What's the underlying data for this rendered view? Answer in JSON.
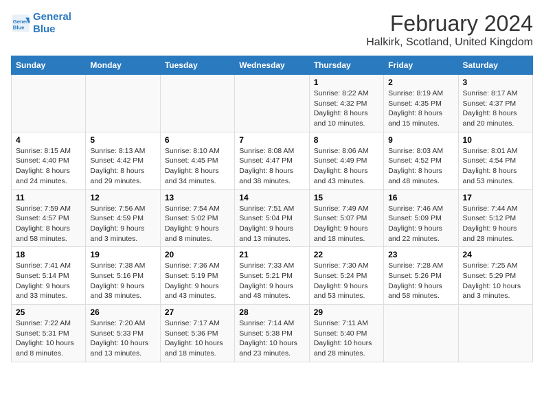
{
  "logo": {
    "line1": "General",
    "line2": "Blue"
  },
  "title": "February 2024",
  "subtitle": "Halkirk, Scotland, United Kingdom",
  "days_of_week": [
    "Sunday",
    "Monday",
    "Tuesday",
    "Wednesday",
    "Thursday",
    "Friday",
    "Saturday"
  ],
  "weeks": [
    [
      {
        "day": "",
        "content": ""
      },
      {
        "day": "",
        "content": ""
      },
      {
        "day": "",
        "content": ""
      },
      {
        "day": "",
        "content": ""
      },
      {
        "day": "1",
        "content": "Sunrise: 8:22 AM\nSunset: 4:32 PM\nDaylight: 8 hours\nand 10 minutes."
      },
      {
        "day": "2",
        "content": "Sunrise: 8:19 AM\nSunset: 4:35 PM\nDaylight: 8 hours\nand 15 minutes."
      },
      {
        "day": "3",
        "content": "Sunrise: 8:17 AM\nSunset: 4:37 PM\nDaylight: 8 hours\nand 20 minutes."
      }
    ],
    [
      {
        "day": "4",
        "content": "Sunrise: 8:15 AM\nSunset: 4:40 PM\nDaylight: 8 hours\nand 24 minutes."
      },
      {
        "day": "5",
        "content": "Sunrise: 8:13 AM\nSunset: 4:42 PM\nDaylight: 8 hours\nand 29 minutes."
      },
      {
        "day": "6",
        "content": "Sunrise: 8:10 AM\nSunset: 4:45 PM\nDaylight: 8 hours\nand 34 minutes."
      },
      {
        "day": "7",
        "content": "Sunrise: 8:08 AM\nSunset: 4:47 PM\nDaylight: 8 hours\nand 38 minutes."
      },
      {
        "day": "8",
        "content": "Sunrise: 8:06 AM\nSunset: 4:49 PM\nDaylight: 8 hours\nand 43 minutes."
      },
      {
        "day": "9",
        "content": "Sunrise: 8:03 AM\nSunset: 4:52 PM\nDaylight: 8 hours\nand 48 minutes."
      },
      {
        "day": "10",
        "content": "Sunrise: 8:01 AM\nSunset: 4:54 PM\nDaylight: 8 hours\nand 53 minutes."
      }
    ],
    [
      {
        "day": "11",
        "content": "Sunrise: 7:59 AM\nSunset: 4:57 PM\nDaylight: 8 hours\nand 58 minutes."
      },
      {
        "day": "12",
        "content": "Sunrise: 7:56 AM\nSunset: 4:59 PM\nDaylight: 9 hours\nand 3 minutes."
      },
      {
        "day": "13",
        "content": "Sunrise: 7:54 AM\nSunset: 5:02 PM\nDaylight: 9 hours\nand 8 minutes."
      },
      {
        "day": "14",
        "content": "Sunrise: 7:51 AM\nSunset: 5:04 PM\nDaylight: 9 hours\nand 13 minutes."
      },
      {
        "day": "15",
        "content": "Sunrise: 7:49 AM\nSunset: 5:07 PM\nDaylight: 9 hours\nand 18 minutes."
      },
      {
        "day": "16",
        "content": "Sunrise: 7:46 AM\nSunset: 5:09 PM\nDaylight: 9 hours\nand 22 minutes."
      },
      {
        "day": "17",
        "content": "Sunrise: 7:44 AM\nSunset: 5:12 PM\nDaylight: 9 hours\nand 28 minutes."
      }
    ],
    [
      {
        "day": "18",
        "content": "Sunrise: 7:41 AM\nSunset: 5:14 PM\nDaylight: 9 hours\nand 33 minutes."
      },
      {
        "day": "19",
        "content": "Sunrise: 7:38 AM\nSunset: 5:16 PM\nDaylight: 9 hours\nand 38 minutes."
      },
      {
        "day": "20",
        "content": "Sunrise: 7:36 AM\nSunset: 5:19 PM\nDaylight: 9 hours\nand 43 minutes."
      },
      {
        "day": "21",
        "content": "Sunrise: 7:33 AM\nSunset: 5:21 PM\nDaylight: 9 hours\nand 48 minutes."
      },
      {
        "day": "22",
        "content": "Sunrise: 7:30 AM\nSunset: 5:24 PM\nDaylight: 9 hours\nand 53 minutes."
      },
      {
        "day": "23",
        "content": "Sunrise: 7:28 AM\nSunset: 5:26 PM\nDaylight: 9 hours\nand 58 minutes."
      },
      {
        "day": "24",
        "content": "Sunrise: 7:25 AM\nSunset: 5:29 PM\nDaylight: 10 hours\nand 3 minutes."
      }
    ],
    [
      {
        "day": "25",
        "content": "Sunrise: 7:22 AM\nSunset: 5:31 PM\nDaylight: 10 hours\nand 8 minutes."
      },
      {
        "day": "26",
        "content": "Sunrise: 7:20 AM\nSunset: 5:33 PM\nDaylight: 10 hours\nand 13 minutes."
      },
      {
        "day": "27",
        "content": "Sunrise: 7:17 AM\nSunset: 5:36 PM\nDaylight: 10 hours\nand 18 minutes."
      },
      {
        "day": "28",
        "content": "Sunrise: 7:14 AM\nSunset: 5:38 PM\nDaylight: 10 hours\nand 23 minutes."
      },
      {
        "day": "29",
        "content": "Sunrise: 7:11 AM\nSunset: 5:40 PM\nDaylight: 10 hours\nand 28 minutes."
      },
      {
        "day": "",
        "content": ""
      },
      {
        "day": "",
        "content": ""
      }
    ]
  ]
}
